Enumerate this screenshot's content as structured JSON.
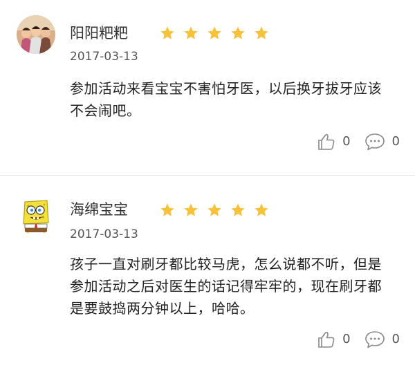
{
  "reviews": [
    {
      "username": "阳阳粑粑",
      "rating": 5,
      "date": "2017-03-13",
      "content": "参加活动来看宝宝不害怕牙医，以后换牙拔牙应该不会闹吧。",
      "likes": "0",
      "comments": "0"
    },
    {
      "username": "海绵宝宝",
      "rating": 5,
      "date": "2017-03-13",
      "content": "孩子一直对刷牙都比较马虎，怎么说都不听，但是参加活动之后对医生的话记得牢牢的，现在刷牙都是要鼓捣两分钟以上，哈哈。",
      "likes": "0",
      "comments": "0"
    }
  ],
  "colors": {
    "star": "#f7c13a",
    "divider": "#e5e5e5",
    "icon": "#888888"
  }
}
